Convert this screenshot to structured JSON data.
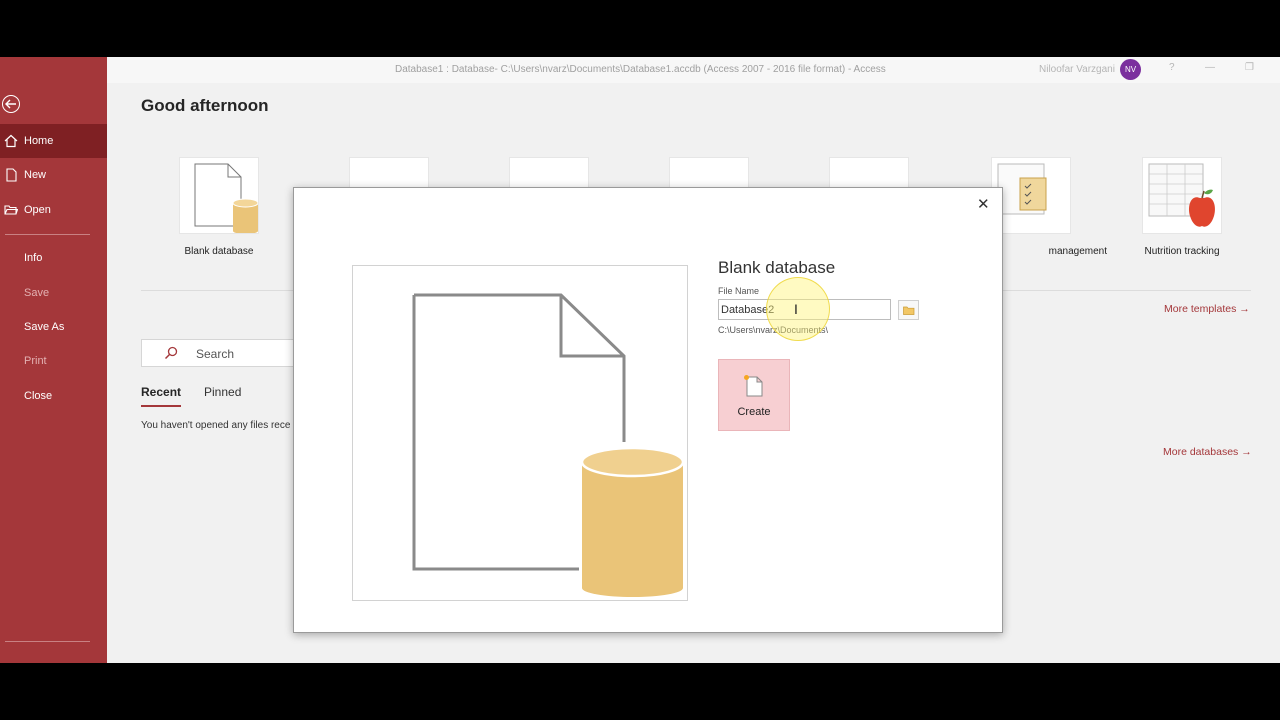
{
  "window": {
    "title": "Database1 : Database- C:\\Users\\nvarz\\Documents\\Database1.accdb (Access 2007 - 2016 file format)  -  Access",
    "user_name": "Niloofar Varzgani",
    "user_initials": "NV",
    "help_label": "?"
  },
  "backstage": {
    "items": [
      {
        "label": "Home"
      },
      {
        "label": "New"
      },
      {
        "label": "Open"
      },
      {
        "label": "Info"
      },
      {
        "label": "Save"
      },
      {
        "label": "Save As"
      },
      {
        "label": "Print"
      },
      {
        "label": "Close"
      }
    ]
  },
  "main": {
    "greeting": "Good afternoon",
    "templates": [
      {
        "label": "Blank database"
      },
      {
        "label": ""
      },
      {
        "label": ""
      },
      {
        "label": ""
      },
      {
        "label": ""
      },
      {
        "label": "management"
      },
      {
        "label": "Nutrition tracking"
      }
    ],
    "more_templates": "More templates",
    "more_databases": "More databases",
    "search_placeholder": "Search",
    "tabs": [
      {
        "label": "Recent"
      },
      {
        "label": "Pinned"
      }
    ],
    "empty_recent": "You haven't opened any files rece"
  },
  "dialog": {
    "title": "Blank database",
    "file_name_label": "File Name",
    "file_name_value": "Database2",
    "path": "C:\\Users\\nvarz\\Documents\\",
    "create_label": "Create",
    "close_glyph": "✕"
  },
  "colors": {
    "accent": "#a4373a",
    "accent_dark": "#7f2023",
    "create_bg": "#f7cfd2",
    "db_gold": "#eac478"
  }
}
